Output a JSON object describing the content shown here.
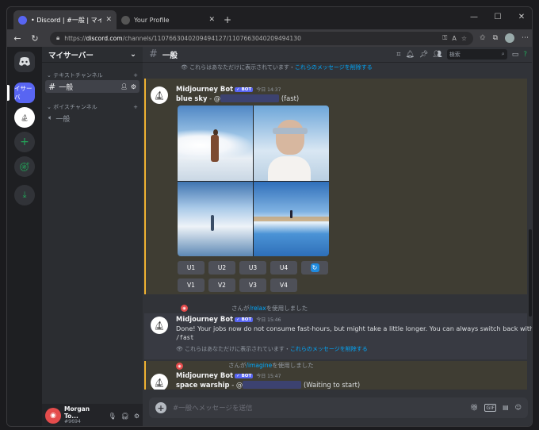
{
  "browser": {
    "tabs": [
      {
        "title": "• Discord | #一般 | マイサーバー",
        "active": true
      },
      {
        "title": "Your Profile",
        "active": false
      }
    ],
    "url_prefix": "https://",
    "url_host": "discord.com",
    "url_path": "/channels/1107663040209494127/1107663040209494130"
  },
  "server": {
    "name": "マイサーバー",
    "server_icon_label": "イサーバ",
    "text_category": "テキストチャンネル",
    "voice_category": "ボイスチャンネル",
    "text_channel": "一般",
    "voice_channel": "一般"
  },
  "user": {
    "name": "Morgan To...",
    "tag": "#9694"
  },
  "header": {
    "channel": "一般",
    "search_placeholder": "検索"
  },
  "messages": {
    "eph_top": "これらはあなただけに表示されています・",
    "eph_link": "これらのメッセージを削除する",
    "m1": {
      "author": "Midjourney Bot",
      "badge": "✓ BOT",
      "time": "今日 14:37",
      "prompt": "blue sky",
      "sep": " - @",
      "suffix": "(fast)"
    },
    "upscale_buttons": [
      "U1",
      "U2",
      "U3",
      "U4"
    ],
    "variation_buttons": [
      "V1",
      "V2",
      "V3",
      "V4"
    ],
    "sys1": {
      "pre": "さんが",
      "cmd": "/relax",
      "post": "を使用しました"
    },
    "m2": {
      "author": "Midjourney Bot",
      "badge": "✓ BOT",
      "time": "今日 15:46",
      "line1": "Done! Your jobs now do not consume fast-hours, but might take a little longer. You can always switch back with",
      "line2": "/fast"
    },
    "eph_mid": "これらはあなただけに表示されています・",
    "eph_mid_link": "これらのメッセージを削除する",
    "sys2": {
      "pre": "さんが",
      "cmd": "/imagine",
      "post": "を使用しました"
    },
    "m3": {
      "author": "Midjourney Bot",
      "badge": "✓ BOT",
      "time": "今日 15:47",
      "prompt": "space warship",
      "sep": " - @",
      "suffix": "(Waiting to start)"
    }
  },
  "input": {
    "placeholder": "#一般へメッセージを送信"
  }
}
